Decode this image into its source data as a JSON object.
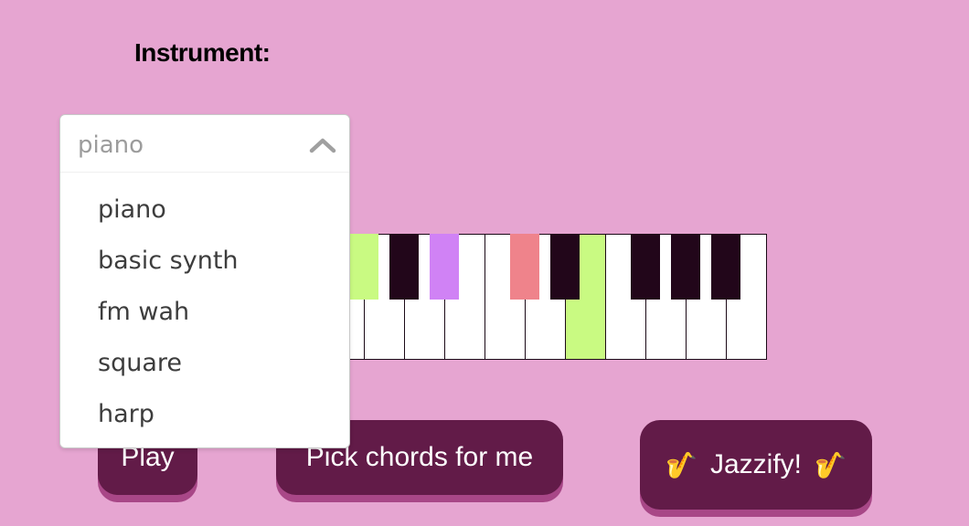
{
  "instrument": {
    "label": "Instrument:",
    "selected": "piano",
    "options": [
      "piano",
      "basic synth",
      "fm wah",
      "square",
      "harp"
    ]
  },
  "keyboard": {
    "white_key_count": 11,
    "highlighted_white_keys": [
      {
        "key": 6,
        "color": "#c9fa82"
      }
    ],
    "black_keys": [
      {
        "color": "#c9fa82"
      },
      {
        "color": "#22061a"
      },
      {
        "color": "#d082f5"
      },
      {
        "color": "#ef838b"
      },
      {
        "color": "#22061a"
      },
      {
        "color": "#22061a"
      },
      {
        "color": "#22061a"
      },
      {
        "color": "#22061a"
      }
    ]
  },
  "buttons": {
    "play": "Play",
    "pick_chords": "Pick chords for me",
    "jazzify": "Jazzify!"
  },
  "icons": {
    "chevron": "chevron-up-icon",
    "saxophone": "saxophone-icon"
  },
  "colors": {
    "background": "#e6a5d1",
    "button": "#621b48",
    "button_shadow": "#a84787"
  }
}
